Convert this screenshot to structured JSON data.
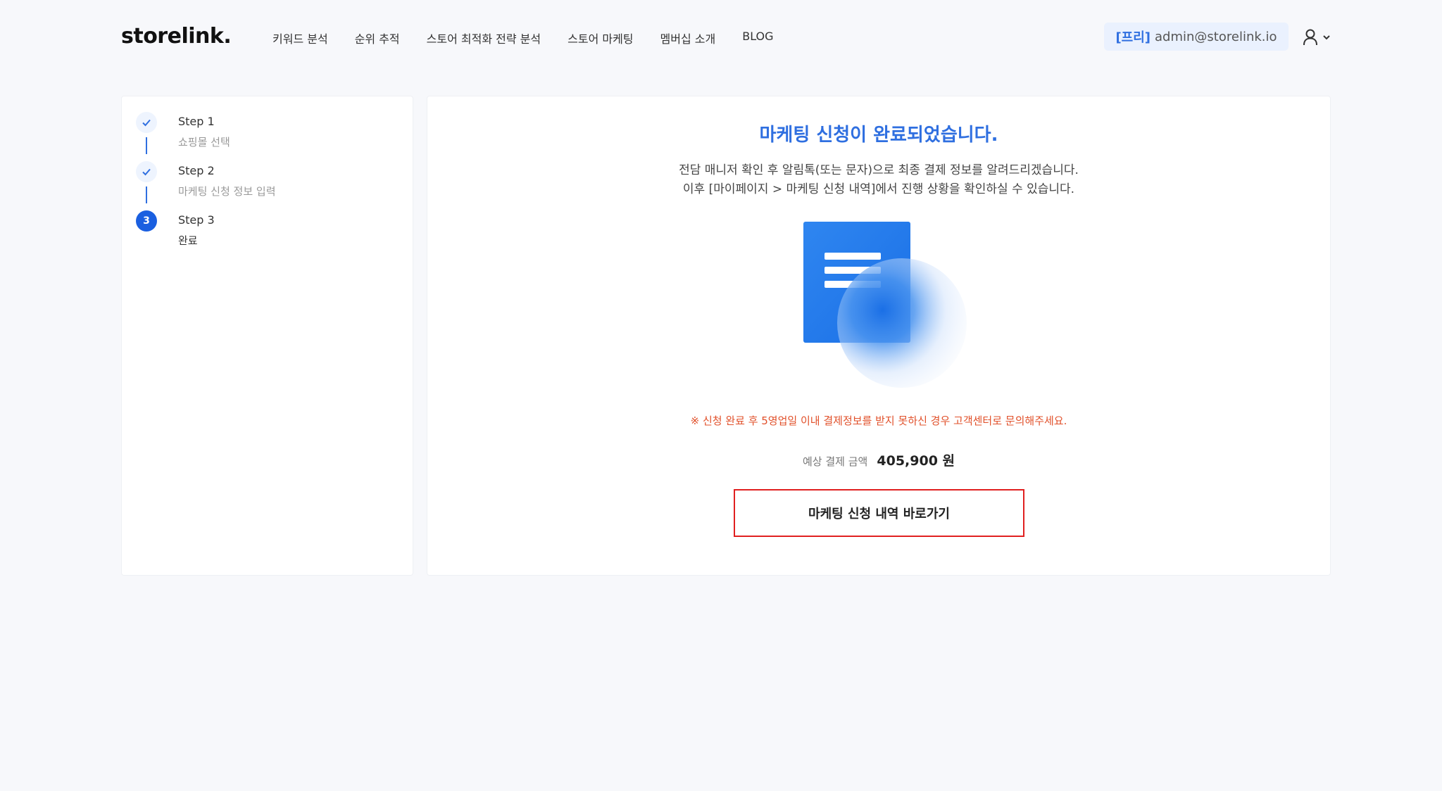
{
  "header": {
    "logo": "storelink.",
    "nav": [
      {
        "label": "키워드 분석"
      },
      {
        "label": "순위 추적"
      },
      {
        "label": "스토어 최적화 전략 분석"
      },
      {
        "label": "스토어 마케팅"
      },
      {
        "label": "멤버십 소개"
      },
      {
        "label": "BLOG"
      }
    ],
    "account": {
      "tier": "[프리]",
      "email": "admin@storelink.io"
    },
    "user_icon": "user-icon",
    "dropdown_icon": "chevron-down-icon"
  },
  "steps": [
    {
      "title": "Step 1",
      "subtitle": "쇼핑몰 선택",
      "status": "done",
      "marker": "check-icon"
    },
    {
      "title": "Step 2",
      "subtitle": "마케팅 신청 정보 입력",
      "status": "done",
      "marker": "check-icon"
    },
    {
      "title": "Step 3",
      "subtitle": "완료",
      "status": "current",
      "number": "3"
    }
  ],
  "main": {
    "title": "마케팅 신청이 완료되었습니다.",
    "desc_line1": "전담 매니저 확인 후 알림톡(또는 문자)으로 최종 결제 정보를 알려드리겠습니다.",
    "desc_line2": "이후 [마이페이지 > 마케팅 신청 내역]에서 진행 상황을 확인하실 수 있습니다.",
    "illustration_icon": "document-icon",
    "notice": "※ 신청 완료 후 5영업일 이내 결제정보를 받지 못하신 경우 고객센터로 문의해주세요.",
    "price_label": "예상 결제 금액",
    "price_value": "405,900 원",
    "button_label": "마케팅 신청 내역 바로가기"
  },
  "colors": {
    "accent": "#2f6fe0",
    "step_current": "#1a5fe0",
    "notice": "#e1502a",
    "button_border": "#e02020",
    "background": "#f7f8fb"
  }
}
